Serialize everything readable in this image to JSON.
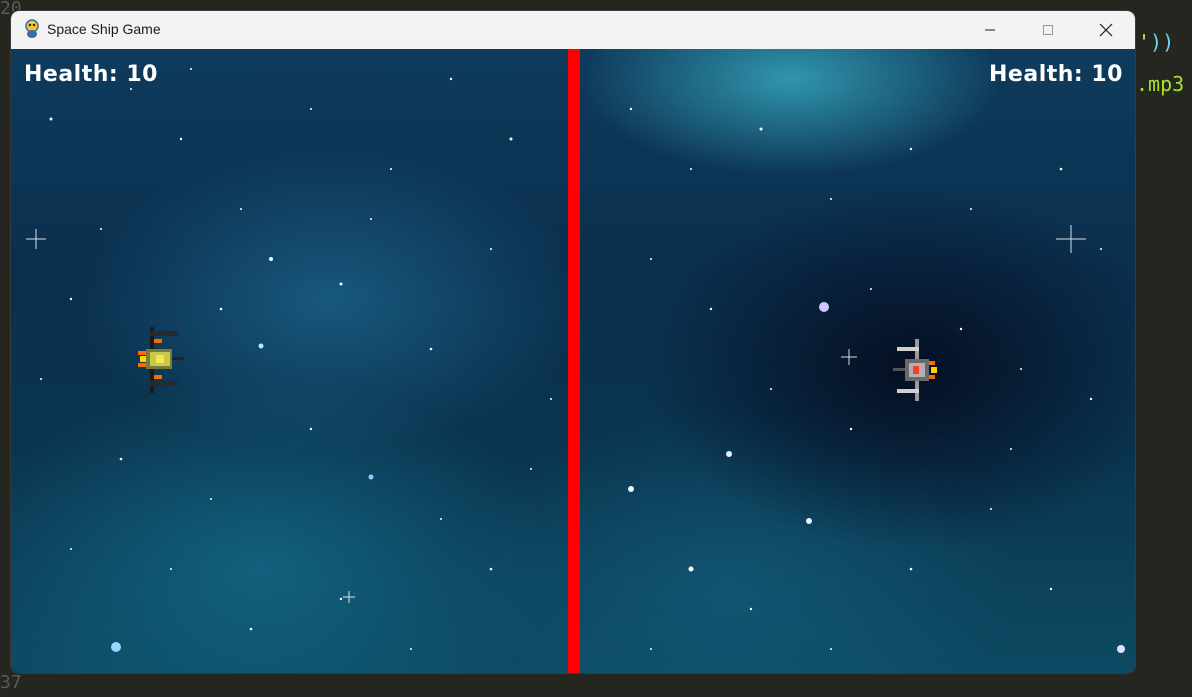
{
  "window": {
    "title": "Space Ship Game",
    "icon": "pygame-snake-icon",
    "controls": [
      "minimize-icon",
      "maximize-icon",
      "close-icon"
    ]
  },
  "game": {
    "left_player": {
      "health_text": "Health: 10",
      "health": 10,
      "ship_color": "yellow"
    },
    "right_player": {
      "health_text": "Health: 10",
      "health": 10,
      "ship_color": "red"
    },
    "divider_color": "#ff0000"
  },
  "background_editor": {
    "code_fragments": [
      "'))",
      ".mp3"
    ],
    "line_number_bottom": "37"
  }
}
